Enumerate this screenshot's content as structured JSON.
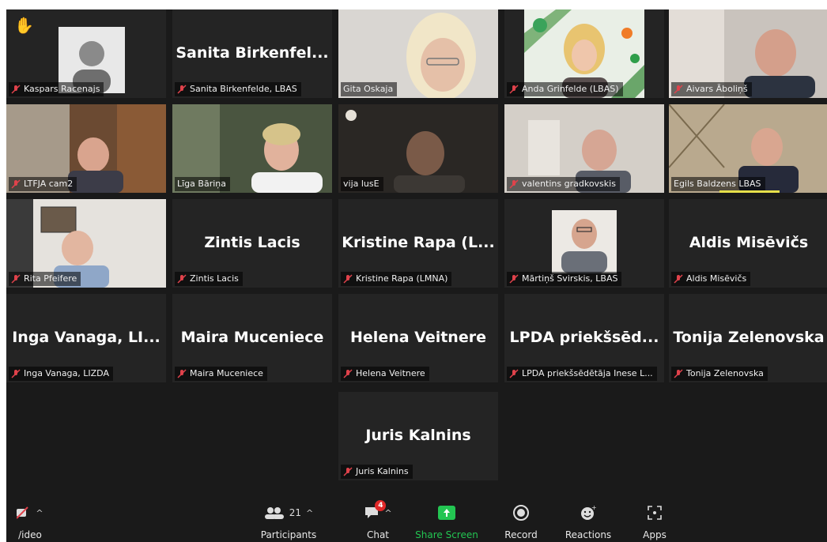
{
  "tiles": [
    {
      "label": "Kaspars Racenajs",
      "big": ""
    },
    {
      "label": "Sanita Birkenfelde, LBAS",
      "big": "Sanita Birkenfel..."
    },
    {
      "label": "Gita Oskaja",
      "big": ""
    },
    {
      "label": "Anda Grinfelde (LBAS)",
      "big": ""
    },
    {
      "label": "Aivars Āboliņš",
      "big": ""
    },
    {
      "label": "LTFJA cam2",
      "big": ""
    },
    {
      "label": "Līga Bāriņa",
      "big": ""
    },
    {
      "label": "vija lusE",
      "big": ""
    },
    {
      "label": "valentins gradkovskis",
      "big": ""
    },
    {
      "label": "Egils Baldzens LBAS",
      "big": ""
    },
    {
      "label": "Rita Pfeifere",
      "big": ""
    },
    {
      "label": "Zintis Lacis",
      "big": "Zintis Lacis"
    },
    {
      "label": "Kristine Rapa (LMNA)",
      "big": "Kristine Rapa (L..."
    },
    {
      "label": "Mārtiņš Svirskis, LBAS",
      "big": ""
    },
    {
      "label": "Aldis Misēvičs",
      "big": "Aldis Misēvičs"
    },
    {
      "label": "Inga Vanaga, LIZDA",
      "big": "Inga Vanaga, LI..."
    },
    {
      "label": "Maira Muceniece",
      "big": "Maira Muceniece"
    },
    {
      "label": "Helena Veitnere",
      "big": "Helena Veitnere"
    },
    {
      "label": "LPDA priekšsēdētāja Inese L...",
      "big": "LPDA priekšsēd..."
    },
    {
      "label": "Tonija Zelenovska",
      "big": "Tonija Zelenovska"
    },
    {
      "label": "Juris Kalnins",
      "big": "Juris Kalnins"
    }
  ],
  "toolbar": {
    "video": "/ideo",
    "participants": "Participants",
    "participants_count": "21",
    "chat": "Chat",
    "chat_badge": "4",
    "share": "Share Screen",
    "record": "Record",
    "reactions": "Reactions",
    "apps": "Apps"
  },
  "colors": {
    "muted": "#e0424b",
    "share_green": "#23c552",
    "active_speaker": "#d9e34e"
  }
}
